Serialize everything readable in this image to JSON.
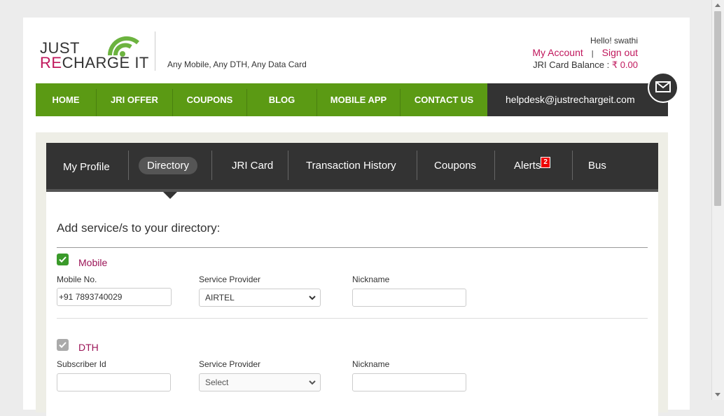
{
  "header": {
    "logo_line1": "JUST",
    "logo_re": "RE",
    "logo_charge": "CHARGE",
    "logo_it": "IT",
    "tagline": "Any Mobile, Any DTH, Any Data Card",
    "greeting": "Hello! swathi",
    "my_account": "My Account",
    "divider": "|",
    "sign_out": "Sign out",
    "balance_label": "JRI Card Balance : ",
    "balance_value": "₹ 0.00"
  },
  "nav": {
    "items": [
      "HOME",
      "JRI OFFER",
      "COUPONS",
      "BLOG",
      "MOBILE APP",
      "CONTACT US"
    ],
    "helpdesk": "helpdesk@justrechargeit.com"
  },
  "tabs": {
    "items": [
      "My Profile",
      "Directory",
      "JRI Card",
      "Transaction History",
      "Coupons",
      "Alerts",
      "Bus"
    ],
    "active": "Directory",
    "alerts_count": "2"
  },
  "directory": {
    "heading": "Add service/s to your directory:",
    "mobile": {
      "title": "Mobile",
      "checked": true,
      "number_label": "Mobile No.",
      "number_value": "+91 7893740029",
      "provider_label": "Service Provider",
      "provider_value": "AIRTEL",
      "nickname_label": "Nickname",
      "nickname_value": ""
    },
    "dth": {
      "title": "DTH",
      "checked": true,
      "id_label": "Subscriber Id",
      "id_value": "",
      "provider_label": "Service Provider",
      "provider_value": "Select",
      "nickname_label": "Nickname",
      "nickname_value": ""
    }
  },
  "colors": {
    "brand_green": "#5b9a14",
    "brand_pink": "#c0175c",
    "dark": "#333333"
  }
}
